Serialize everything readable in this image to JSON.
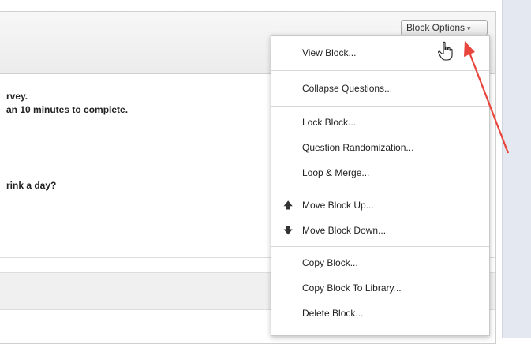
{
  "block": {
    "options_button": {
      "label": "Block Options",
      "caret": "▾"
    },
    "questions": [
      {
        "text": "rvey."
      },
      {
        "text": "an 10 minutes to complete."
      },
      {
        "text": "rink a day?"
      }
    ]
  },
  "menu": {
    "groups": [
      {
        "items": [
          {
            "label": "View Block..."
          }
        ]
      },
      {
        "items": [
          {
            "label": "Collapse Questions..."
          }
        ]
      },
      {
        "items": [
          {
            "label": "Lock Block..."
          },
          {
            "label": "Question Randomization..."
          },
          {
            "label": "Loop & Merge..."
          }
        ]
      },
      {
        "items": [
          {
            "label": "Move Block Up...",
            "icon": "arrow-up-icon",
            "glyph": "🡅"
          },
          {
            "label": "Move Block Down...",
            "icon": "arrow-down-icon",
            "glyph": "🡇"
          }
        ]
      },
      {
        "items": [
          {
            "label": "Copy Block..."
          },
          {
            "label": "Copy Block To Library..."
          },
          {
            "label": "Delete Block..."
          }
        ]
      }
    ]
  },
  "colors": {
    "annotation_arrow": "#e8453c",
    "sidebar_strip": "#e4e9f1"
  }
}
